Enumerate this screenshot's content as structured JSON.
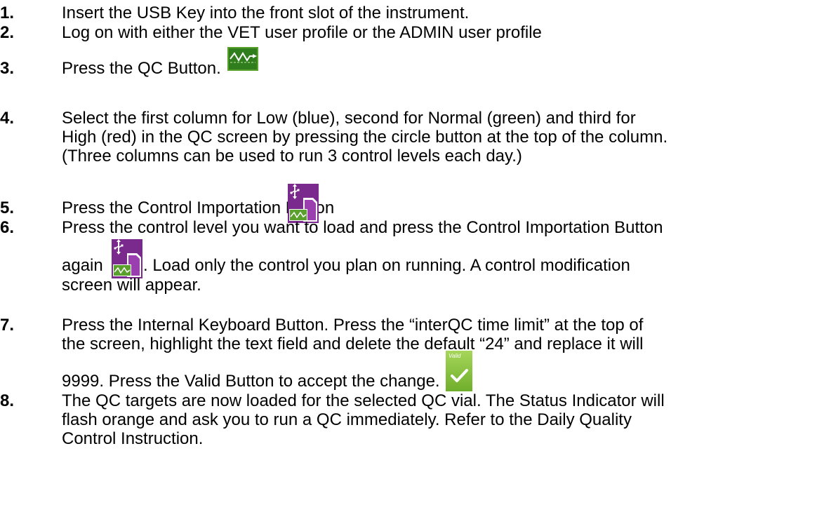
{
  "steps": [
    {
      "num": "1",
      "lines": [
        "Insert the USB Key into the front slot of the instrument."
      ]
    },
    {
      "num": "2",
      "lines": [
        "Log on with either the VET user profile or the ADMIN user profile"
      ]
    },
    {
      "num": "3",
      "lines": [
        "Press the QC Button."
      ]
    },
    {
      "num": "4",
      "lines": [
        "Select the first column for Low (blue), second for Normal (green) and third for",
        "High (red) in the QC screen by pressing the circle button at the top of the column.",
        "(Three columns can be used to run 3 control levels each day.)"
      ]
    },
    {
      "num": "5",
      "lines": [
        "Press the Control Importation Button"
      ]
    },
    {
      "num": "6",
      "lines": [
        "Press the control level you want to load and press the Control Importation Button",
        "again",
        ". Load only the control you plan on running. A control modification",
        "screen will appear."
      ]
    },
    {
      "num": "7",
      "lines": [
        "Press the Internal Keyboard Button. Press the “interQC time limit” at the top of",
        "the screen, highlight the text field and delete the default “24” and replace it will",
        "9999. Press the Valid Button to accept the change."
      ]
    },
    {
      "num": "8",
      "lines": [
        "The QC targets are now loaded for the selected QC vial. The Status Indicator will",
        "flash orange and ask you to run a QC immediately. Refer to the Daily Quality",
        "Control Instruction."
      ]
    }
  ],
  "separator": ".",
  "valid_icon_label": "Valid",
  "icons": {
    "qc": "qc-chart-icon",
    "import": "control-importation-icon",
    "valid": "valid-check-icon"
  },
  "colors": {
    "qc_green": "#5aa02c",
    "import_purple": "#7a2a8c",
    "valid_green": "#8cc63f"
  }
}
